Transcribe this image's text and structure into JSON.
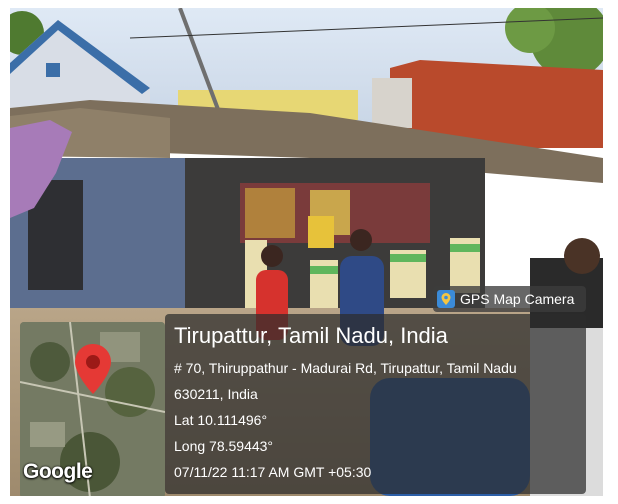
{
  "overlay_badge": {
    "label": "GPS Map Camera",
    "icon": "map-pin-camera-icon"
  },
  "location": {
    "title": "Tirupattur, Tamil Nadu, India",
    "address_line1": "# 70, Thiruppathur - Madurai Rd, Tirupattur, Tamil Nadu",
    "address_line2": "630211, India",
    "latitude": "Lat 10.111496°",
    "longitude": "Long 78.59443°",
    "timestamp": "07/11/22 11:17 AM GMT +05:30"
  },
  "map": {
    "brand": "Google",
    "marker_icon": "map-marker-icon",
    "marker_color": "#e53935"
  }
}
